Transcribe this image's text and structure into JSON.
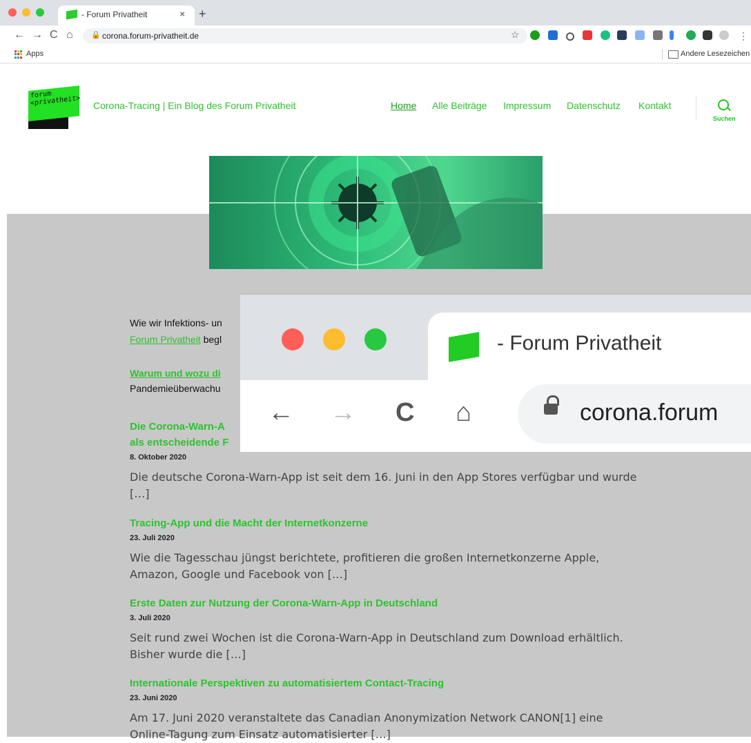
{
  "browser": {
    "tab_title": "- Forum Privatheit",
    "tab_close": "×",
    "new_tab": "+",
    "url": "corona.forum-privatheit.de",
    "bookmarks": {
      "apps": "Apps",
      "other": "Andere Lesezeichen"
    }
  },
  "site": {
    "logo_text": "forum\n<privatheit>",
    "title": "Corona-Tracing | Ein Blog des Forum Privatheit",
    "menu": [
      "Home",
      "Alle Beiträge",
      "Impressum",
      "Datenschutz",
      "Kontakt"
    ],
    "search_label": "Suchen"
  },
  "intro": {
    "line1": "Wie wir Infektions- un",
    "link": "Forum Privatheit",
    "line2_tail": " begl",
    "warum": "Warum und wozu di",
    "pandemie": "Pandemieüberwachu"
  },
  "posts": [
    {
      "title": "Die Corona-Warn-A",
      "title2": "als entscheidende F",
      "date": "8. Oktober 2020",
      "excerpt": "Die deutsche Corona-Warn-App ist seit dem 16. Juni in den App Stores verfügbar und wurde […]"
    },
    {
      "title": "Tracing-App und die Macht der Internetkonzerne",
      "date": "23. Juli 2020",
      "excerpt": "Wie die Tagesschau jüngst berichtete, profitieren die großen Internetkonzerne Apple, Amazon, Google und Facebook von […]"
    },
    {
      "title": "Erste Daten zur Nutzung der Corona-Warn-App in Deutschland",
      "date": "3. Juli 2020",
      "excerpt": "Seit rund zwei Wochen ist die Corona-Warn-App in Deutschland zum Download erhältlich. Bisher wurde die […]"
    },
    {
      "title": "Internationale Perspektiven zu automatisiertem Contact-Tracing",
      "date": "23. Juni 2020",
      "excerpt": "Am 17. Juni 2020 veranstaltete das Canadian Anonymization Network CANON[1] eine Online-Tagung zum Einsatz automatisierter […]"
    }
  ],
  "zoom": {
    "tab_title": "- Forum Privatheit",
    "url": "corona.forum"
  },
  "colors": {
    "brand_green": "#2ec22e",
    "gray_bg": "#c8c8c8"
  }
}
